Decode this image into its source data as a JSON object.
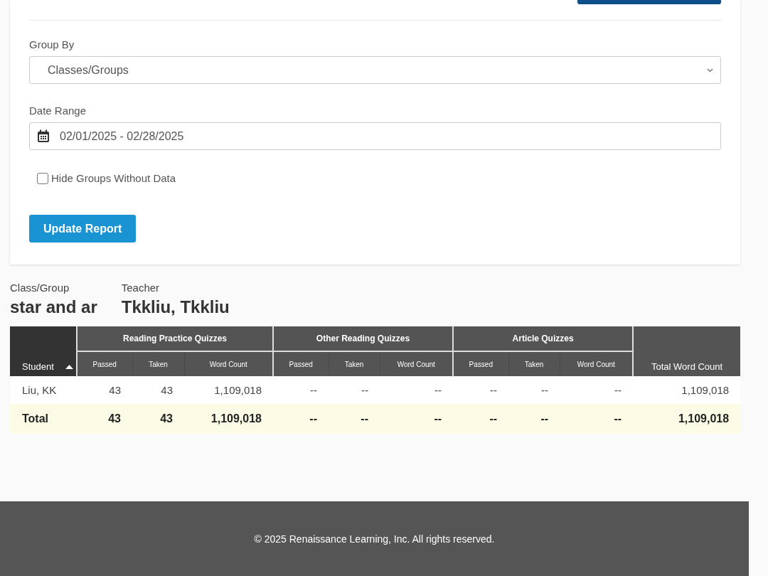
{
  "filters": {
    "group_by": {
      "label": "Group By",
      "value": "Classes/Groups"
    },
    "date_range": {
      "label": "Date Range",
      "value": "02/01/2025 - 02/28/2025"
    },
    "hide_groups": {
      "label": "Hide Groups Without Data",
      "checked": false
    },
    "update_button": "Update Report"
  },
  "summary": [
    {
      "label": "Class/Group",
      "value": "star and ar"
    },
    {
      "label": "Teacher",
      "value": "Tkkliu, Tkkliu"
    }
  ],
  "table": {
    "student_column": "Student",
    "groups": [
      {
        "title": "Reading Practice Quizzes",
        "sub_columns": [
          "Passed",
          "Taken",
          "Word Count"
        ]
      },
      {
        "title": "Other Reading Quizzes",
        "sub_columns": [
          "Passed",
          "Taken",
          "Word Count"
        ]
      },
      {
        "title": "Article Quizzes",
        "sub_columns": [
          "Passed",
          "Taken",
          "Word Count"
        ]
      }
    ],
    "total_column": "Total Word Count",
    "rows": [
      {
        "kind": "student",
        "cells": [
          "Liu, KK",
          "43",
          "43",
          "1,109,018",
          "--",
          "--",
          "--",
          "--",
          "--",
          "--",
          "1,109,018"
        ]
      },
      {
        "kind": "total",
        "cells": [
          "Total",
          "43",
          "43",
          "1,109,018",
          "--",
          "--",
          "--",
          "--",
          "--",
          "--",
          "1,109,018"
        ]
      }
    ]
  },
  "footer": "© 2025 Renaissance Learning, Inc. All rights reserved."
}
